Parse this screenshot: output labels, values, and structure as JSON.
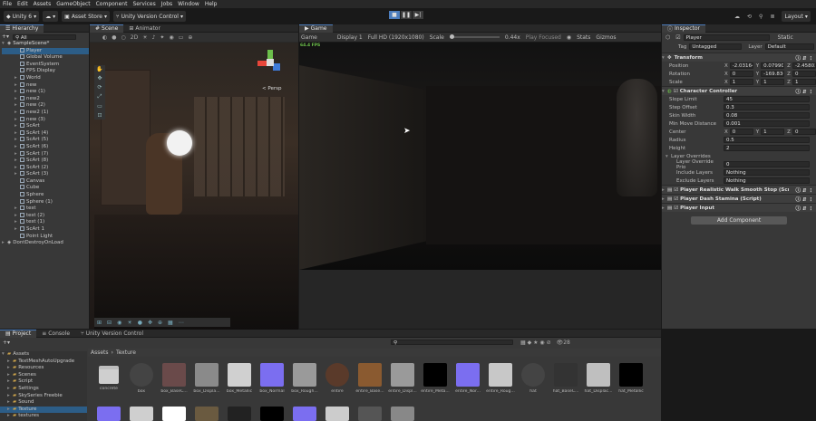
{
  "menubar": [
    "File",
    "Edit",
    "Assets",
    "GameObject",
    "Component",
    "Services",
    "Jobs",
    "Window",
    "Help"
  ],
  "toolbar": {
    "account": "Unity 6",
    "asset_store": "Asset Store",
    "version_control": "Unity Version Control",
    "layout": "Layout"
  },
  "hierarchy": {
    "tab": "Hierarchy",
    "search_placeholder": "All",
    "scene": "SampleScene*",
    "items": [
      "Player",
      "Global Volume",
      "EventSystem",
      "FPS Display",
      "World",
      "new",
      "new (1)",
      "new2",
      "new (2)",
      "new2 (1)",
      "new (3)",
      "ScArt",
      "ScArt (4)",
      "ScArt (5)",
      "ScArt (6)",
      "ScArt (7)",
      "ScArt (8)",
      "ScArt (2)",
      "ScArt (3)",
      "Canvas",
      "Cube",
      "Sphere",
      "Sphere (1)",
      "test",
      "test (2)",
      "test (1)",
      "ScArt 1",
      "Point Light"
    ],
    "dont_destroy": "DontDestroyOnLoad"
  },
  "scene_view": {
    "tabs": [
      "Scene",
      "Animator"
    ],
    "persp": "< Persp"
  },
  "game_view": {
    "tab": "Game",
    "mode": "Game",
    "display": "Display 1",
    "resolution": "Full HD (1920x1080)",
    "scale_label": "Scale",
    "scale_value": "0.44x",
    "play_focused": "Play Focused",
    "stats": "Stats",
    "gizmos": "Gizmos",
    "fps": "64.4 FPS"
  },
  "inspector": {
    "tab": "Inspector",
    "object_name": "Player",
    "static": "Static",
    "tag_label": "Tag",
    "tag": "Untagged",
    "layer_label": "Layer",
    "layer": "Default",
    "transform": {
      "title": "Transform",
      "position_label": "Position",
      "rotation_label": "Rotation",
      "scale_label": "Scale",
      "position": [
        "-2.03164",
        "0.07990(",
        "-2.45803"
      ],
      "rotation": [
        "0",
        "-169.836",
        "0"
      ],
      "scale": [
        "1",
        "1",
        "1"
      ]
    },
    "char_controller": {
      "title": "Character Controller",
      "rows": [
        {
          "label": "Slope Limit",
          "value": "45"
        },
        {
          "label": "Step Offset",
          "value": "0.3"
        },
        {
          "label": "Skin Width",
          "value": "0.08"
        },
        {
          "label": "Min Move Distance",
          "value": "0.001"
        }
      ],
      "center_label": "Center",
      "center": [
        "0",
        "1",
        "0"
      ],
      "radius_label": "Radius",
      "radius": "0.5",
      "height_label": "Height",
      "height": "2",
      "layer_overrides": "Layer Overrides",
      "override_prio_label": "Layer Override Prio",
      "override_prio": "0",
      "include_label": "Include Layers",
      "include": "Nothing",
      "exclude_label": "Exclude Layers",
      "exclude": "Nothing"
    },
    "scripts": [
      "Player Realistic Walk Smooth Stop (Script",
      "Player Dash Stamina (Script)",
      "Player Input"
    ],
    "add_component": "Add Component"
  },
  "project": {
    "tabs": [
      "Project",
      "Console",
      "Unity Version Control"
    ],
    "folders": [
      "Assets",
      "TextMeshAutoUpgrade",
      "Resources",
      "Scenes",
      "Script",
      "Settings",
      "SkySeries Freebie",
      "Sound",
      "Texture",
      "textures"
    ],
    "breadcrumb": [
      "Assets",
      "Texture"
    ],
    "count": "28",
    "assets": [
      {
        "name": "concrete",
        "color": "#cfcfcf"
      },
      {
        "name": "box",
        "color": "#444444"
      },
      {
        "name": "box_BaseC...",
        "color": "#6a4a4a"
      },
      {
        "name": "box_Displa...",
        "color": "#8a8a8a"
      },
      {
        "name": "box_Metallic",
        "color": "#d0d0d0"
      },
      {
        "name": "box_Normal",
        "color": "#7b6ef0"
      },
      {
        "name": "box_Rough...",
        "color": "#9a9a9a"
      },
      {
        "name": "entire",
        "color": "#5a3a2a"
      },
      {
        "name": "entire_Base...",
        "color": "#8a5a30"
      },
      {
        "name": "entire_Displ...",
        "color": "#9a9a9a"
      },
      {
        "name": "entire_Meta...",
        "color": "#000000"
      },
      {
        "name": "entire_Nor...",
        "color": "#7b6ef0"
      },
      {
        "name": "entire_Roug...",
        "color": "#c8c8c8"
      },
      {
        "name": "hat",
        "color": "#444444"
      },
      {
        "name": "hat_BaseC...",
        "color": "#333333"
      },
      {
        "name": "hat_Displac...",
        "color": "#bfbfbf"
      },
      {
        "name": "hat_Metallic",
        "color": "#000000"
      }
    ]
  },
  "colors": {
    "accent": "#4c7dbd",
    "fps": "#6ec24b",
    "normal_map": "#7b6ef0"
  }
}
